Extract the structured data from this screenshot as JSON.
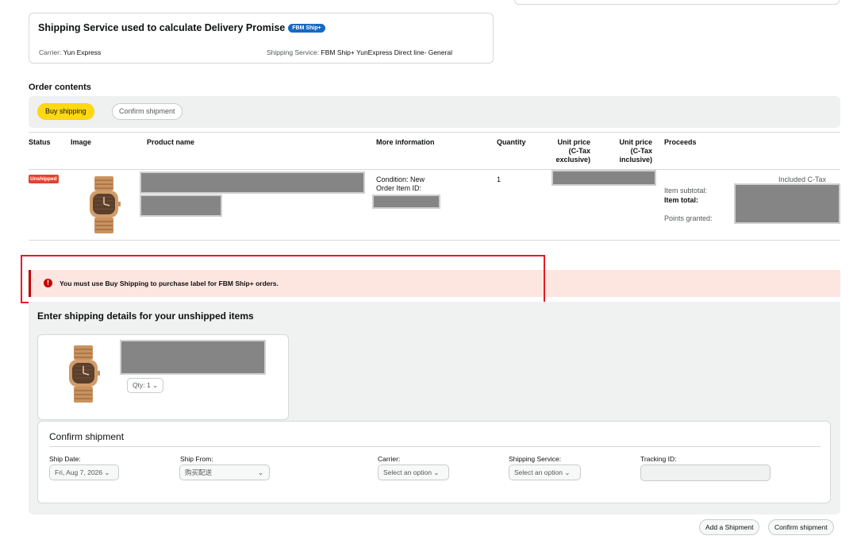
{
  "shipping_card": {
    "title": "Shipping Service used to calculate Delivery Promise",
    "badge": "FBM Ship+",
    "carrier_label": "Carrier:",
    "carrier_value": "Yun Express",
    "service_label": "Shipping Service:",
    "service_value": "FBM Ship+ YunExpress Direct line- General"
  },
  "order_contents": {
    "heading": "Order contents",
    "buy_shipping_label": "Buy shipping",
    "confirm_shipment_label": "Confirm shipment"
  },
  "table": {
    "headers": {
      "status": "Status",
      "image": "Image",
      "product_name": "Product name",
      "more_info": "More information",
      "quantity": "Quantity",
      "unit_price_ex_1": "Unit price",
      "unit_price_ex_2": "(C-Tax",
      "unit_price_ex_3": "exclusive)",
      "unit_price_in_1": "Unit price",
      "unit_price_in_2": "(C-Tax",
      "unit_price_in_3": "inclusive)",
      "proceeds": "Proceeds"
    },
    "row": {
      "status_badge": "Unshipped",
      "condition": "Condition: New",
      "order_item_id_label": "Order Item ID:",
      "quantity": "1",
      "included_ctax": "Included C-Tax",
      "item_subtotal_label": "Item subtotal:",
      "item_total_label": "Item total:",
      "points_granted_label": "Points granted:"
    }
  },
  "alert": {
    "icon_glyph": "!",
    "message": "You must use Buy Shipping to purchase label for FBM Ship+ orders."
  },
  "details": {
    "heading": "Enter shipping details for your unshipped items",
    "qty_label": "Qty: 1 ⌄",
    "confirm_heading": "Confirm shipment",
    "ship_date_label": "Ship Date:",
    "ship_date_value": "Fri, Aug 7, 2026 ⌄",
    "ship_from_label": "Ship From:",
    "ship_from_value": "购买配送",
    "ship_from_chevron": "⌄",
    "carrier_label": "Carrier:",
    "carrier_value": "Select an option ⌄",
    "service_label": "Shipping Service:",
    "service_value": "Select an option ⌄",
    "tracking_label": "Tracking ID:"
  },
  "footer": {
    "add_shipment_label": "Add a Shipment",
    "confirm_shipment_label": "Confirm shipment"
  },
  "colors": {
    "buy_yellow": "#ffd814",
    "badge_blue": "#1668c1",
    "unshipped_red": "#e3442b",
    "alert_bg": "#fde5e0",
    "highlight_box": "#e31c23"
  }
}
